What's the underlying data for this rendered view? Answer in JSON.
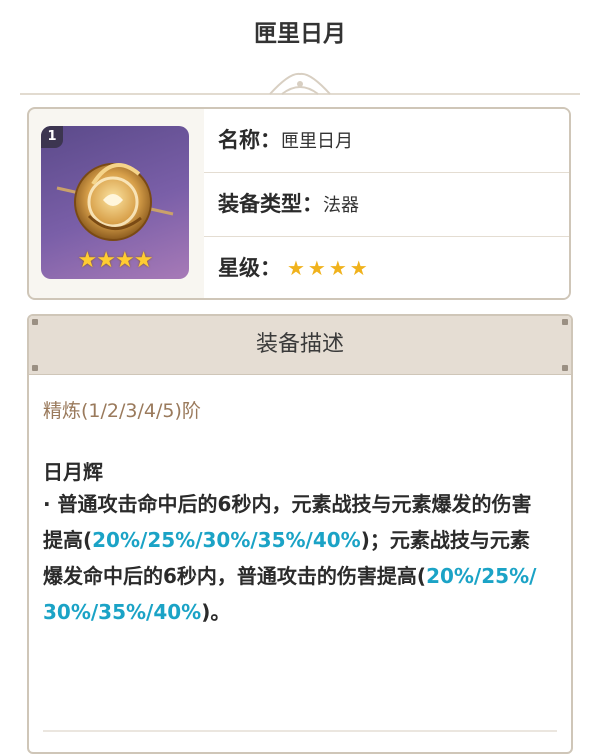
{
  "page": {
    "title": "匣里日月"
  },
  "weapon": {
    "refine_badge": "1",
    "name_label": "名称：",
    "name": "匣里日月",
    "type_label": "装备类型：",
    "type": "法器",
    "rarity_label": "星级：",
    "rarity_stars": "★★★★",
    "rarity_value": 4,
    "thumb_stars": "★★★★"
  },
  "description": {
    "header": "装备描述",
    "refine_line": "精炼(1/2/3/4/5)阶",
    "effect_name": "日月辉",
    "effect_parts": [
      "· 普通攻击命中后的6秒内，元素战技与元素爆发的伤害提高(",
      "20%/25%/30%/35%/40%",
      ")；元素战技与元素爆发命中后的6秒内，普通攻击的伤害提高(",
      "20%/25%/30%/35%/40%",
      ")。"
    ]
  },
  "colors": {
    "highlight": "#1ba3c6",
    "refine_text": "#9a7a5c",
    "star": "#f0b21c",
    "header_bg": "#e5ddd3",
    "thumb_bg": "#6b52a0"
  },
  "icons": {
    "divider": "ornamental-divider-icon",
    "weapon": "catalyst-weapon-icon",
    "star": "star-icon"
  }
}
